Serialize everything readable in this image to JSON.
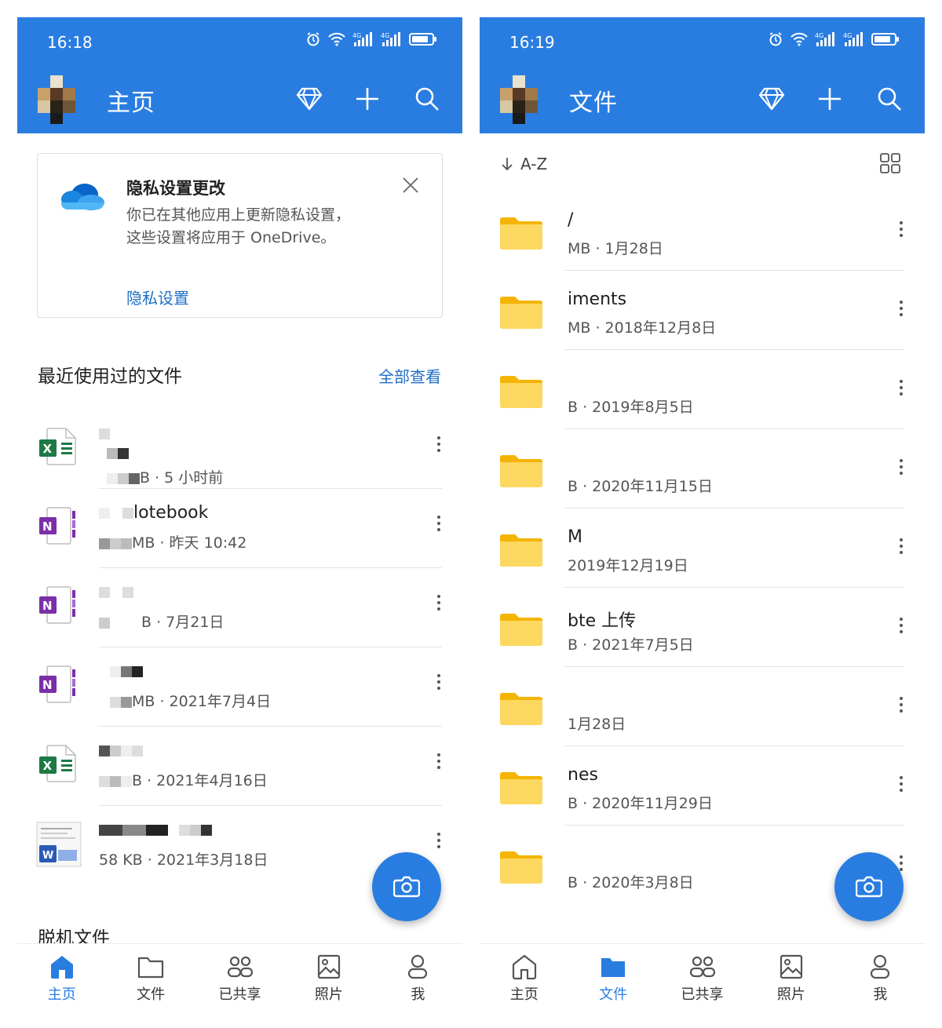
{
  "left": {
    "status_time": "16:18",
    "title": "主页",
    "privacy_card": {
      "title": "隐私设置更改",
      "body": "你已在其他应用上更新隐私设置，这些设置将应用于 OneDrive。",
      "link": "隐私设置"
    },
    "recent": {
      "heading": "最近使用过的文件",
      "view_all": "全部查看",
      "items": [
        {
          "type": "excel",
          "name": "",
          "meta": "B · 5 小时前"
        },
        {
          "type": "onenote",
          "name": "lotebook",
          "meta": "MB · 昨天 10:42"
        },
        {
          "type": "onenote",
          "name": "",
          "meta": "B · 7月21日"
        },
        {
          "type": "onenote",
          "name": "",
          "meta": "MB · 2021年7月4日"
        },
        {
          "type": "excel",
          "name": "",
          "meta": "B · 2021年4月16日"
        },
        {
          "type": "word",
          "name": "",
          "meta": "58 KB · 2021年3月18日"
        }
      ]
    },
    "offline_heading": "脱机文件",
    "nav": [
      {
        "label": "主页",
        "icon": "home-icon",
        "active": true
      },
      {
        "label": "文件",
        "icon": "folder-icon",
        "active": false
      },
      {
        "label": "已共享",
        "icon": "people-icon",
        "active": false
      },
      {
        "label": "照片",
        "icon": "photo-icon",
        "active": false
      },
      {
        "label": "我",
        "icon": "person-icon",
        "active": false
      }
    ]
  },
  "right": {
    "status_time": "16:19",
    "title": "文件",
    "sort_label": "A-Z",
    "folders": [
      {
        "name": "/",
        "meta": "MB · 1月28日"
      },
      {
        "name": "iments",
        "meta": "MB · 2018年12月8日"
      },
      {
        "name": "",
        "meta": "B · 2019年8月5日"
      },
      {
        "name": "",
        "meta": "B · 2020年11月15日"
      },
      {
        "name": "M",
        "meta": "2019年12月19日"
      },
      {
        "name": "bte 上传",
        "meta": "B · 2021年7月5日"
      },
      {
        "name": "",
        "meta": "1月28日"
      },
      {
        "name": "nes",
        "meta": "B · 2020年11月29日"
      },
      {
        "name": "",
        "meta": "B · 2020年3月8日"
      }
    ],
    "nav": [
      {
        "label": "主页",
        "icon": "home-icon",
        "active": false
      },
      {
        "label": "文件",
        "icon": "folder-icon",
        "active": true
      },
      {
        "label": "已共享",
        "icon": "people-icon",
        "active": false
      },
      {
        "label": "照片",
        "icon": "photo-icon",
        "active": false
      },
      {
        "label": "我",
        "icon": "person-icon",
        "active": false
      }
    ]
  },
  "colors": {
    "brand_blue": "#2a7de0",
    "link_blue": "#1f6fc5",
    "folder_yellow": "#fcd860",
    "excel_green": "#1d7a45",
    "onenote_purple": "#7b2fa8",
    "word_blue": "#2b5ab5"
  }
}
